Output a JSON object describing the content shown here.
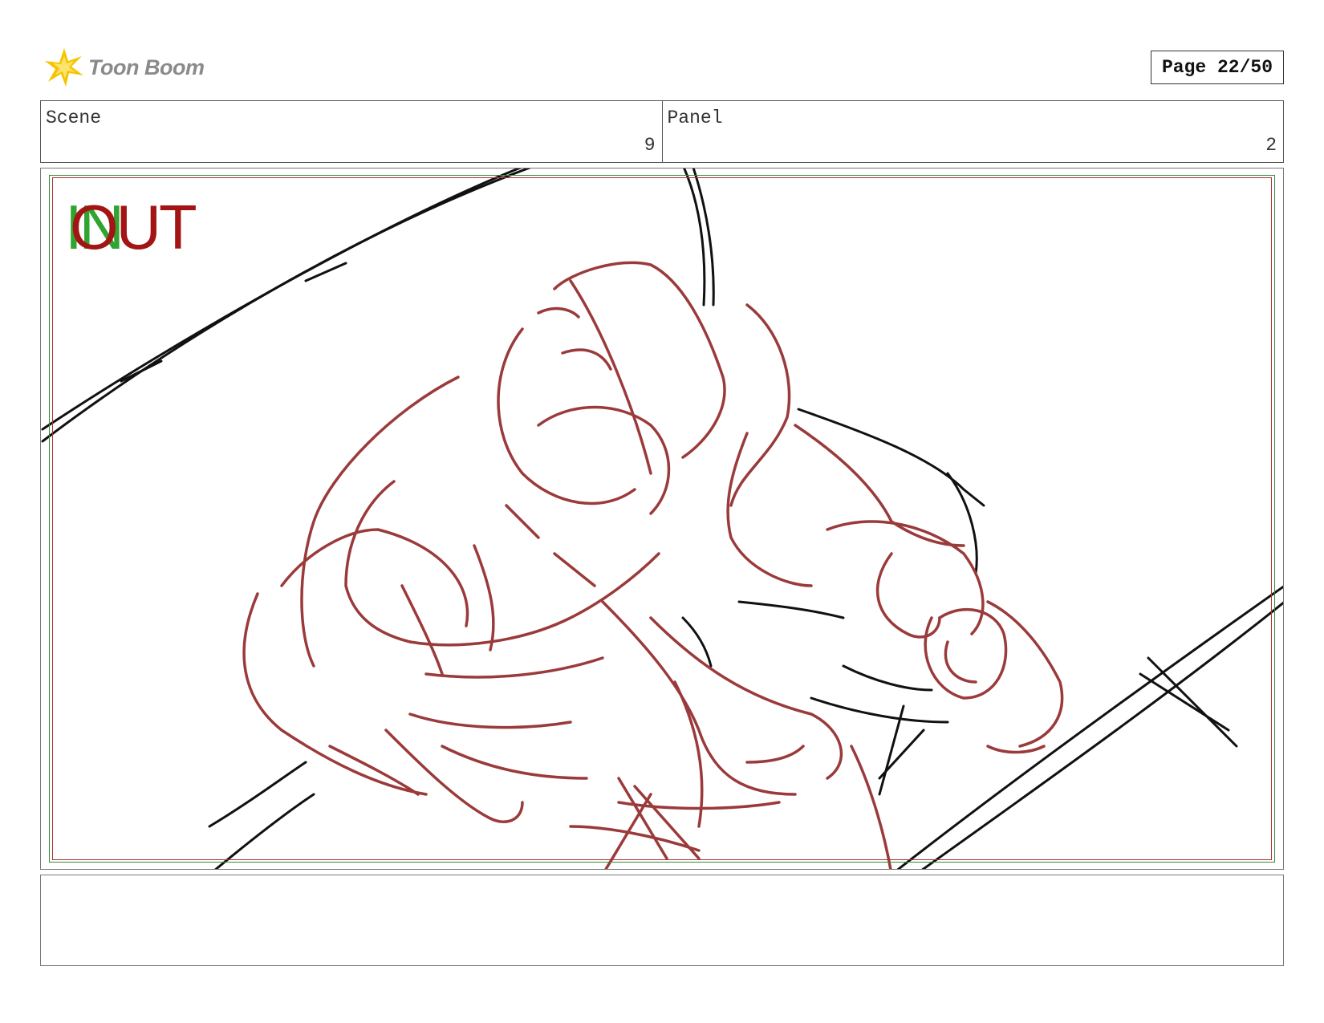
{
  "header": {
    "logo_text": "Toon Boom",
    "logo_icon": "star-burst-icon",
    "page_label": "Page 22/50"
  },
  "info": {
    "scene_label": "Scene",
    "scene_value": "9",
    "panel_label": "Panel",
    "panel_value": "2"
  },
  "panel": {
    "marker_in": "IN",
    "marker_out": "OUT",
    "sketch_colors": {
      "character": "#9b3a3a",
      "environment": "#111111"
    }
  },
  "notes": {
    "text": ""
  }
}
